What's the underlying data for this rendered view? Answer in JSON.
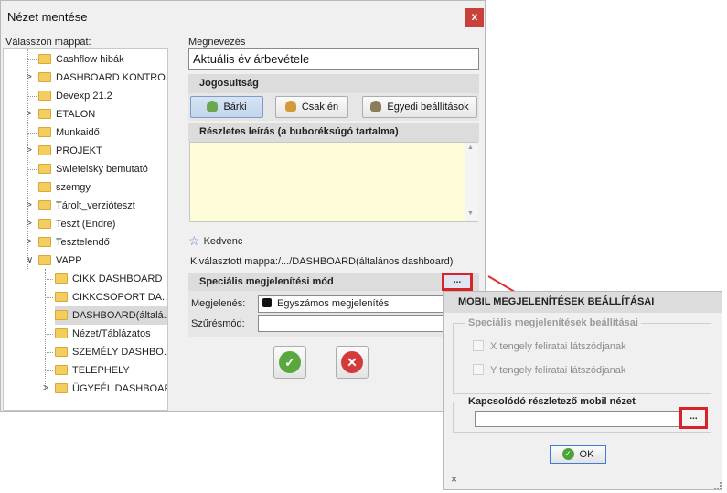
{
  "window": {
    "title": "Nézet mentése",
    "close": "x"
  },
  "folder_panel": {
    "label": "Válasszon mappát:",
    "items": [
      {
        "label": "Cashflow hibák"
      },
      {
        "label": "DASHBOARD KONTRO..."
      },
      {
        "label": "Devexp 21.2"
      },
      {
        "label": "ETALON"
      },
      {
        "label": "Munkaidő"
      },
      {
        "label": "PROJEKT"
      },
      {
        "label": "Swietelsky bemutató"
      },
      {
        "label": "szemgy"
      },
      {
        "label": "Tárolt_verzióteszt"
      },
      {
        "label": "Teszt (Endre)"
      },
      {
        "label": "Tesztelendő"
      },
      {
        "label": "VAPP"
      },
      {
        "label": "CIKK DASHBOARD"
      },
      {
        "label": "CIKKCSOPORT DA..."
      },
      {
        "label": "DASHBOARD(általá..."
      },
      {
        "label": "Nézet/Táblázatos"
      },
      {
        "label": "SZEMÉLY DASHBO..."
      },
      {
        "label": "TELEPHELY"
      },
      {
        "label": "ÜGYFÉL DASHBOARD"
      }
    ]
  },
  "form": {
    "name_label": "Megnevezés",
    "name_value": "Aktuális év árbevétele",
    "permissions_title": "Jogosultság",
    "perm_anyone": "Bárki",
    "perm_only_me": "Csak én",
    "perm_custom": "Egyedi beállítások",
    "description_title": "Részletes leírás (a buboréksúgó tartalma)",
    "description_value": "",
    "favorite_label": "Kedvenc",
    "selected_folder": "Kiválasztott mappa:/.../DASHBOARD(általános dashboard)",
    "special_mode_title": "Speciális megjelenítési mód",
    "dots": "...",
    "display_label": "Megjelenés:",
    "display_value": "Egyszámos megjelenítés",
    "filter_label": "Szűrésmód:",
    "filter_value": ""
  },
  "mobile_dialog": {
    "title": "MOBIL MEGJELENÍTÉSEK BEÁLLÍTÁSAI",
    "special_group": "Speciális megjelenítések beállításai",
    "x_axis": "X tengely feliratai látszódjanak",
    "y_axis": "Y tengely feliratai látszódjanak",
    "linked_title": "Kapcsolódó részletező mobil nézet",
    "linked_value": "",
    "dots": "...",
    "ok": "OK",
    "close": "×"
  },
  "colors": {
    "highlight": "#d9232a",
    "description_bg": "#fffdd9",
    "section_header": "#dcdcdc"
  }
}
